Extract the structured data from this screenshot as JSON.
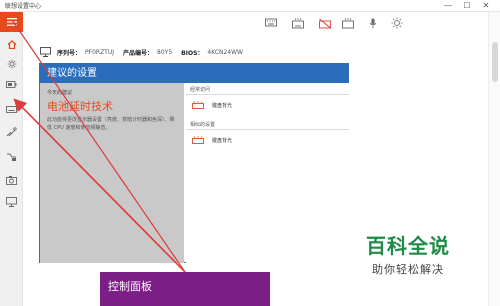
{
  "window": {
    "title": "联想设置中心",
    "min_glyph": "—",
    "max_glyph": "☐",
    "close_glyph": "✕"
  },
  "device": {
    "serial_label": "序列号：",
    "serial_value": "PF0RZTUJ",
    "product_label": "产品编号：",
    "product_value": "80Y5",
    "bios_label": "BIOS：",
    "bios_value": "4KCN24WW"
  },
  "panel": {
    "header": "建议的设置",
    "today_label": "今天的建议",
    "suggest_title": "电池延时技术",
    "suggest_desc": "此功能将更改显示器设置（亮度、变暗计时器和色深）、降低 CPU 速度和使音频静音。",
    "section1_label": "经常访问",
    "item1_label": "键盘背光",
    "section2_label": "相似的设置",
    "item2_label": "键盘背光"
  },
  "callout": {
    "label": "控制面板"
  },
  "watermark": {
    "big": "百科全说",
    "small": "助你轻松解决"
  },
  "colors": {
    "accent_blue": "#2a6ebb",
    "accent_orange": "#e8491c",
    "callout_purple": "#7b1f86",
    "watermark_green": "#1e8b46",
    "arrow_red": "#e03a3a"
  },
  "icons": {
    "sidebar": [
      "hamburger-menu-icon",
      "home-icon",
      "light-bulb-icon",
      "battery-icon",
      "keyboard-icon",
      "mouse-icon",
      "graphics-card-icon",
      "camera-icon",
      "display-icon"
    ],
    "toolbar": [
      "keyboard-icon",
      "keyboard-backlight-icon",
      "keyboard-off-icon",
      "keyboard-backlight-icon",
      "microphone-icon",
      "brightness-icon"
    ]
  }
}
